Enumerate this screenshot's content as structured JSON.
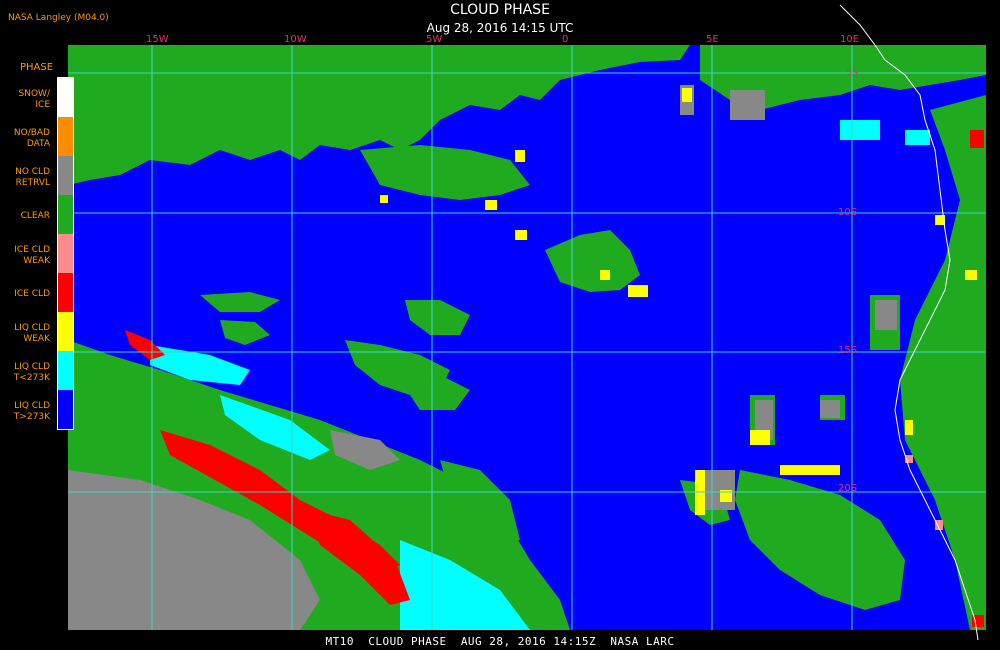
{
  "header": {
    "title": "CLOUD PHASE",
    "subtitle": "Aug 28, 2016 14:15 UTC",
    "brand": "NASA Langley (M04.0)"
  },
  "footer": {
    "text": "MT10  CLOUD PHASE  AUG 28, 2016 14:15Z  NASA LARC"
  },
  "grid": {
    "lon_labels": [
      "15W",
      "10W",
      "5W",
      "0",
      "5E",
      "10E"
    ],
    "lat_labels": [
      "5S",
      "10S",
      "15S",
      "20S"
    ],
    "color": "#3cd6c8"
  },
  "legend": {
    "title": "PHASE",
    "items": [
      {
        "label": "SNOW/\nICE",
        "color": "#ffffff"
      },
      {
        "label": "NO/BAD\nDATA",
        "color": "#ff8c00"
      },
      {
        "label": "NO CLD\nRETRVL",
        "color": "#888888"
      },
      {
        "label": "CLEAR",
        "color": "#1faa1f"
      },
      {
        "label": "ICE CLD\nWEAK",
        "color": "#ff8c8c"
      },
      {
        "label": "ICE CLD",
        "color": "#ff0000"
      },
      {
        "label": "LIQ CLD\nWEAK",
        "color": "#ffff00"
      },
      {
        "label": "LIQ CLD\nT<273K",
        "color": "#00ffff"
      },
      {
        "label": "LIQ CLD\nT>273K",
        "color": "#0000ff"
      }
    ]
  },
  "colors": {
    "ocean_liq_warm": "#0000ff",
    "clear": "#1faa1f",
    "no_retrieval": "#888888",
    "ice": "#ff0000",
    "liq_weak": "#ffff00",
    "liq_cold": "#00ffff",
    "ice_weak": "#ff8c8c",
    "coast": "#ffffff"
  }
}
